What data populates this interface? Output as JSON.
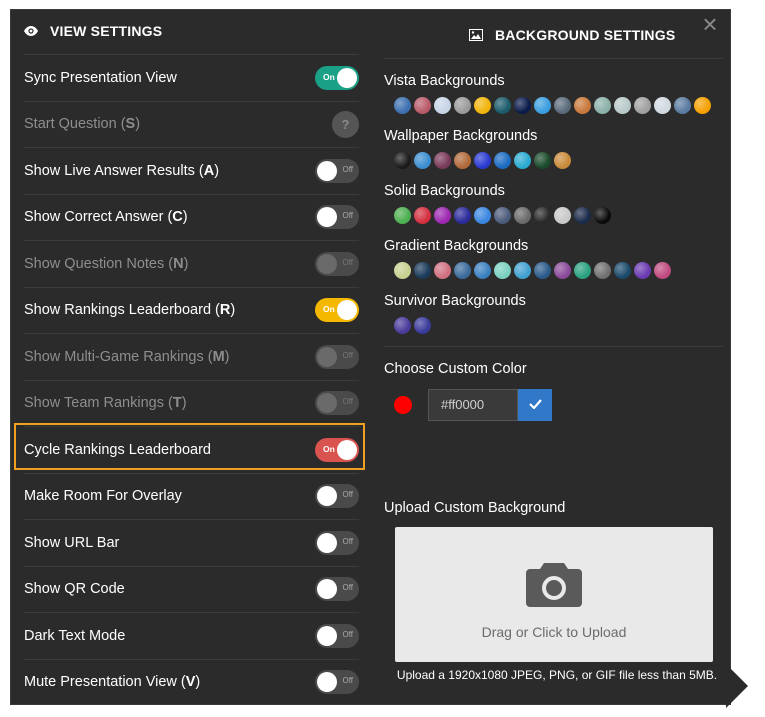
{
  "close_label": "×",
  "view": {
    "title": "VIEW SETTINGS",
    "rows": [
      {
        "text": "Sync Presentation View",
        "key": "",
        "state": "on",
        "color": "#1aa086",
        "dim": false,
        "toggle_text": "On"
      },
      {
        "text": "Start Question (",
        "key": "S",
        "suffix": ")",
        "state": "help",
        "dim": true,
        "toggle_text": "?"
      },
      {
        "text": "Show Live Answer Results (",
        "key": "A",
        "suffix": ")",
        "state": "off",
        "dim": false,
        "toggle_text": "Off"
      },
      {
        "text": "Show Correct Answer (",
        "key": "C",
        "suffix": ")",
        "state": "off",
        "dim": false,
        "toggle_text": "Off"
      },
      {
        "text": "Show Question Notes (",
        "key": "N",
        "suffix": ")",
        "state": "dis",
        "dim": true,
        "toggle_text": "Off"
      },
      {
        "text": "Show Rankings Leaderboard (",
        "key": "R",
        "suffix": ")",
        "state": "on",
        "color": "#f5b800",
        "dim": false,
        "toggle_text": "On"
      },
      {
        "text": "Show Multi-Game Rankings (",
        "key": "M",
        "suffix": ")",
        "state": "dis",
        "dim": true,
        "toggle_text": "Off"
      },
      {
        "text": "Show Team Rankings (",
        "key": "T",
        "suffix": ")",
        "state": "dis",
        "dim": true,
        "toggle_text": "Off"
      },
      {
        "text": "Cycle Rankings Leaderboard",
        "key": "",
        "state": "on",
        "color": "#d9534f",
        "dim": false,
        "toggle_text": "On"
      },
      {
        "text": "Make Room For Overlay",
        "key": "",
        "state": "off",
        "dim": false,
        "toggle_text": "Off"
      },
      {
        "text": "Show URL Bar",
        "key": "",
        "state": "off",
        "dim": false,
        "toggle_text": "Off"
      },
      {
        "text": "Show QR Code",
        "key": "",
        "state": "off",
        "dim": false,
        "toggle_text": "Off"
      },
      {
        "text": "Dark Text Mode",
        "key": "",
        "state": "off",
        "dim": false,
        "toggle_text": "Off"
      },
      {
        "text": "Mute Presentation View (",
        "key": "V",
        "suffix": ")",
        "state": "off",
        "dim": false,
        "toggle_text": "Off"
      }
    ]
  },
  "background": {
    "title": "BACKGROUND SETTINGS",
    "groups": [
      {
        "label": "Vista Backgrounds",
        "colors": [
          "#3d6fb0",
          "#b95a6a",
          "#c7d4e6",
          "#9a9a9a",
          "#f2b40a",
          "#1a5a6a",
          "#0a1a4a",
          "#3a9de0",
          "#5a6a7a",
          "#c8783a",
          "#8ab0a8",
          "#b8c8c8",
          "#a0a0a0",
          "#d0d8e0",
          "#5a7aa0",
          "#f5a000"
        ]
      },
      {
        "label": "Wallpaper Backgrounds",
        "colors": [
          "#1a1a1a",
          "#3b8ed0",
          "#7a3a5a",
          "#b06a3a",
          "#2a3ad0",
          "#1a6ac0",
          "#2aaad0",
          "#1a4a2a",
          "#c88a3a"
        ]
      },
      {
        "label": "Solid Backgrounds",
        "colors": [
          "#4caf50",
          "#d32f3f",
          "#9c27b0",
          "#2a2a9a",
          "#3a86e0",
          "#4a5a7a",
          "#6a6a6a",
          "#2a2a2a",
          "#c8c8c8",
          "#1a2a4a",
          "#0a0a0a"
        ]
      },
      {
        "label": "Gradient Backgrounds",
        "colors": [
          "#c8d090",
          "#1a3a5a",
          "#d07080",
          "#3a6a9a",
          "#3a80c0",
          "#7ad0c0",
          "#40a0d0",
          "#2a5a8a",
          "#8a4a9a",
          "#2aa080",
          "#707070",
          "#1a4a6a",
          "#6a3ab0",
          "#c04a80"
        ]
      },
      {
        "label": "Survivor Backgrounds",
        "colors": [
          "#4a3a9a",
          "#3a3a9a"
        ]
      }
    ],
    "custom_color_label": "Choose Custom Color",
    "custom_color_value": "#ff0000",
    "custom_color_swatch": "#ff0000",
    "upload_label": "Upload Custom Background",
    "upload_text": "Drag or Click to Upload",
    "upload_note": "Upload a 1920x1080 JPEG, PNG, or GIF file less than 5MB."
  }
}
